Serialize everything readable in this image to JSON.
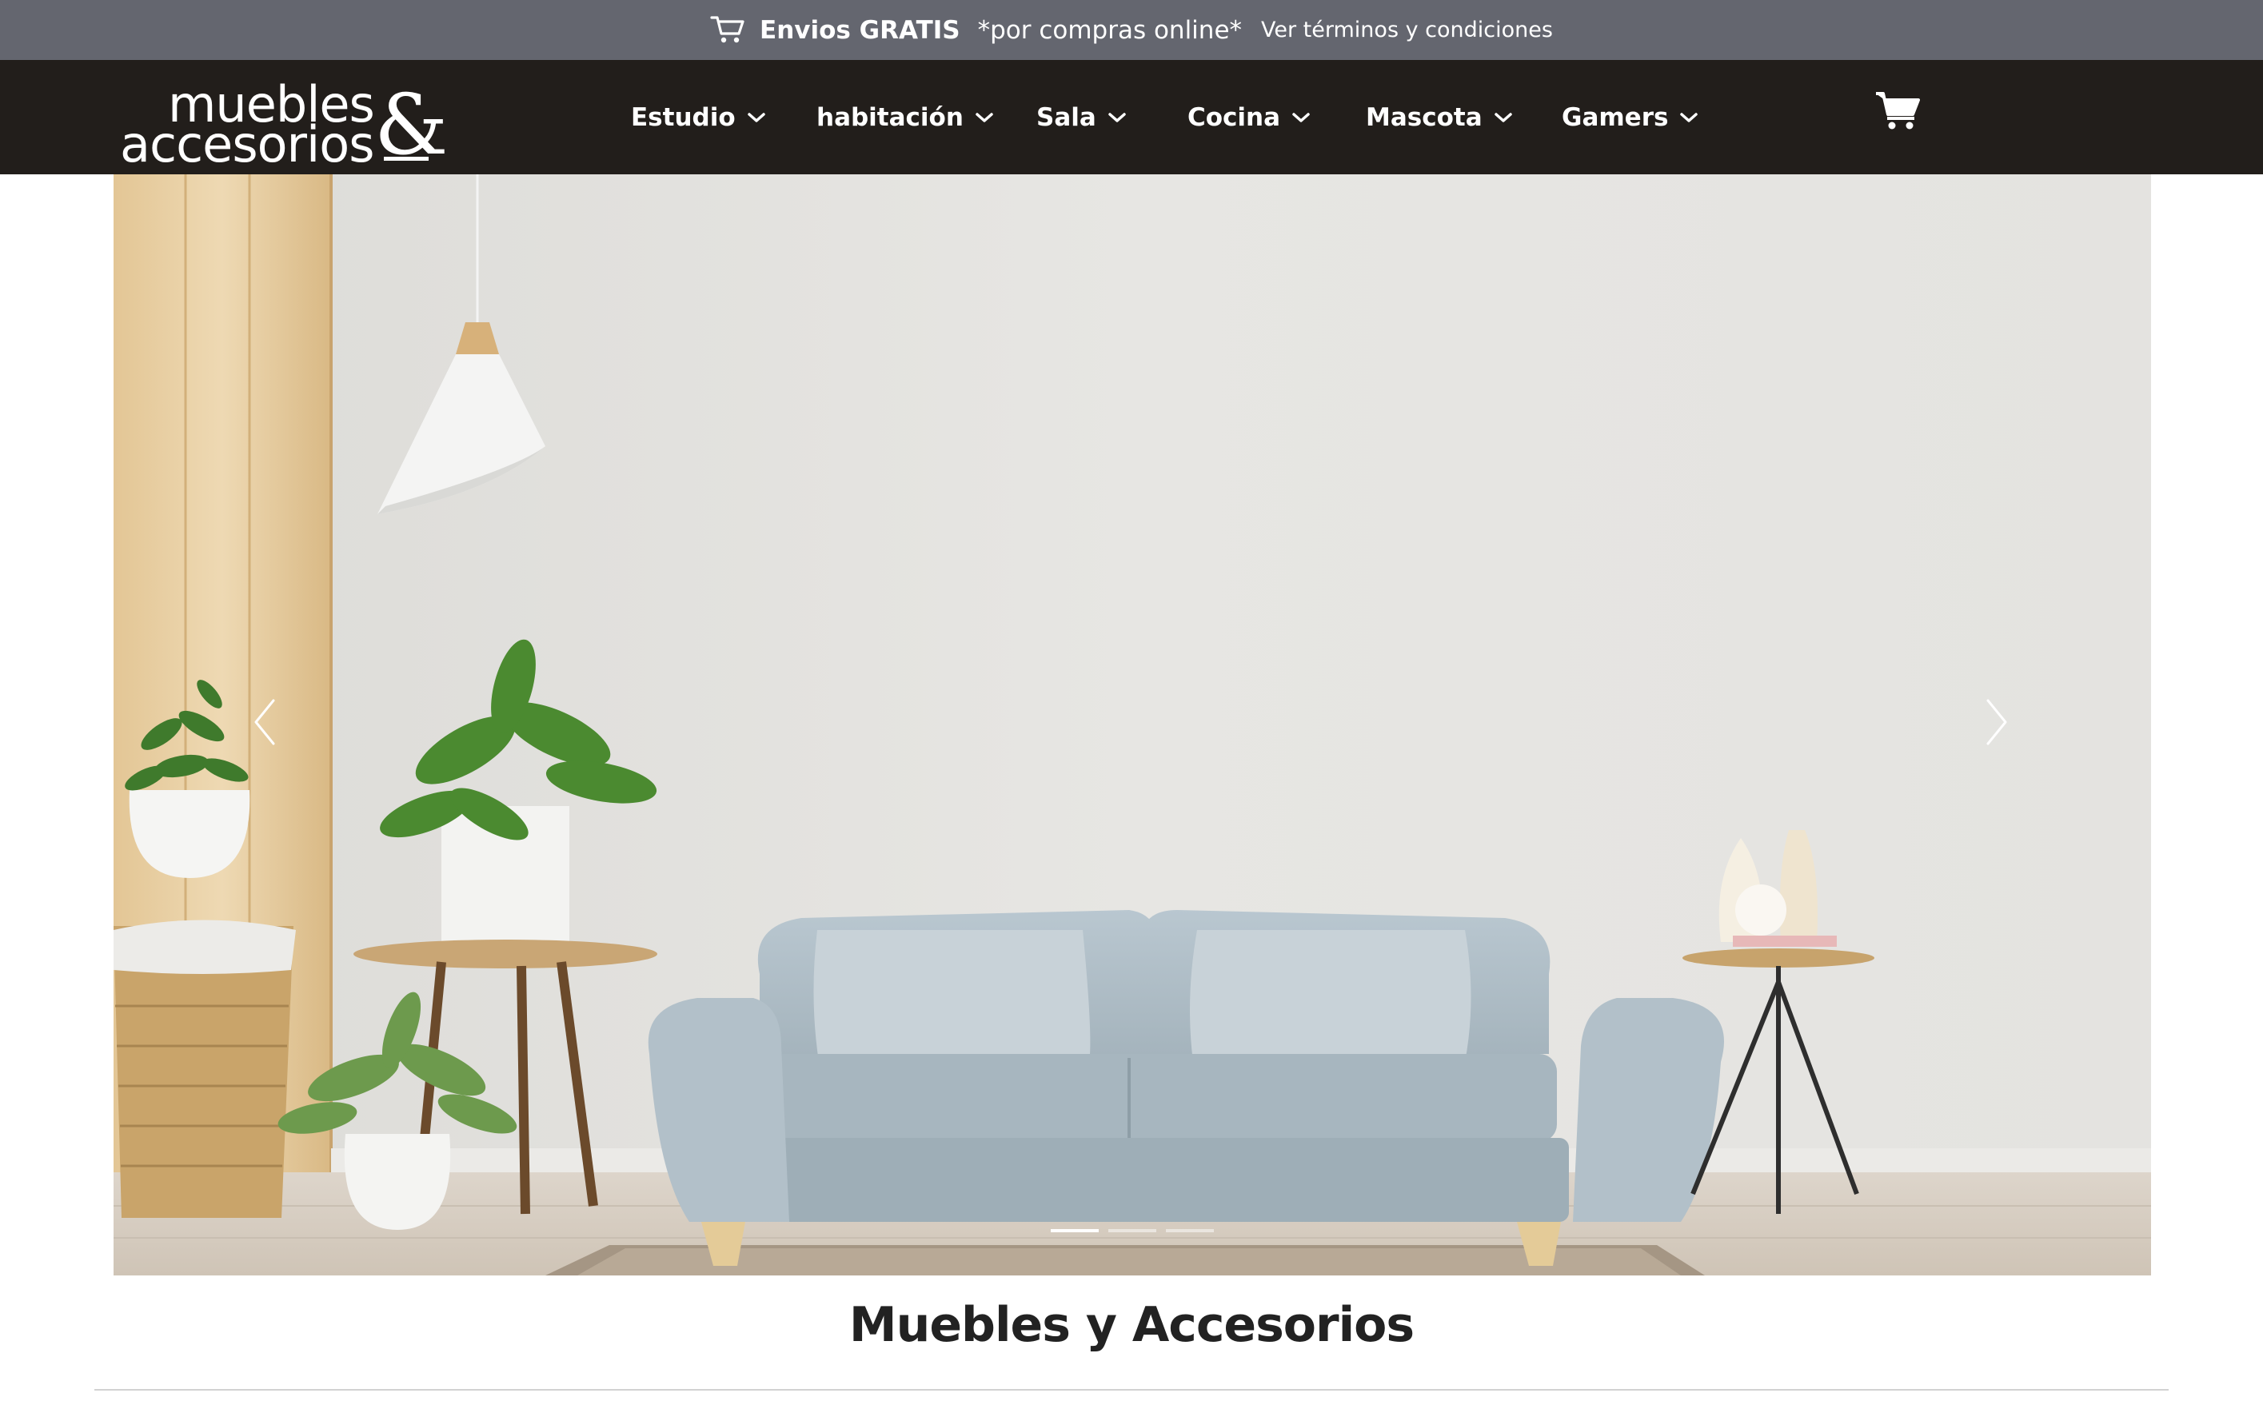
{
  "promo": {
    "icon": "cart-outline-icon",
    "strong": "Envios GRATIS",
    "mid": "*por compras online*",
    "terms_link": "Ver términos y condiciones"
  },
  "brand": {
    "logo_line1": "muebles",
    "logo_line2": "accesorios",
    "logo_amp": "&"
  },
  "nav": {
    "items": [
      {
        "label": "Estudio"
      },
      {
        "label": "habitación"
      },
      {
        "label": "Sala"
      },
      {
        "label": "Cocina"
      },
      {
        "label": "Mascota"
      },
      {
        "label": "Gamers"
      }
    ],
    "cart_icon": "cart-icon"
  },
  "carousel": {
    "slide_count": 3,
    "active_index": 0,
    "prev_icon": "chevron-left-icon",
    "next_icon": "chevron-right-icon"
  },
  "main": {
    "section_title": "Muebles y Accesorios"
  },
  "colors": {
    "promo_bg": "#64666f",
    "nav_bg": "#221e1b",
    "text_dark": "#222222",
    "white": "#ffffff"
  }
}
